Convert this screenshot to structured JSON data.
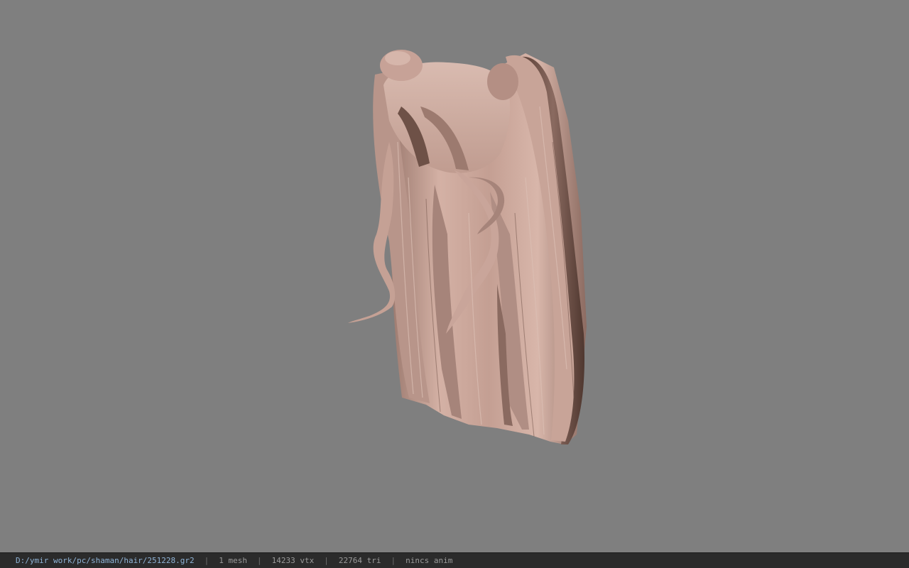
{
  "viewer": {
    "background_color": "#7f7f7f",
    "model_subject": "hair mesh (long twin-tail hairstyle)",
    "hair_color": "#c9a79c",
    "hair_shadow_color": "#6e5147"
  },
  "statusbar": {
    "file_path": "D:/ymir work/pc/shaman/hair/251228.gr2",
    "separator": "|",
    "mesh_count": "1 mesh",
    "vertex_count": "14233 vtx",
    "triangle_count": "22764 tri",
    "anim_status": "nincs anim"
  }
}
